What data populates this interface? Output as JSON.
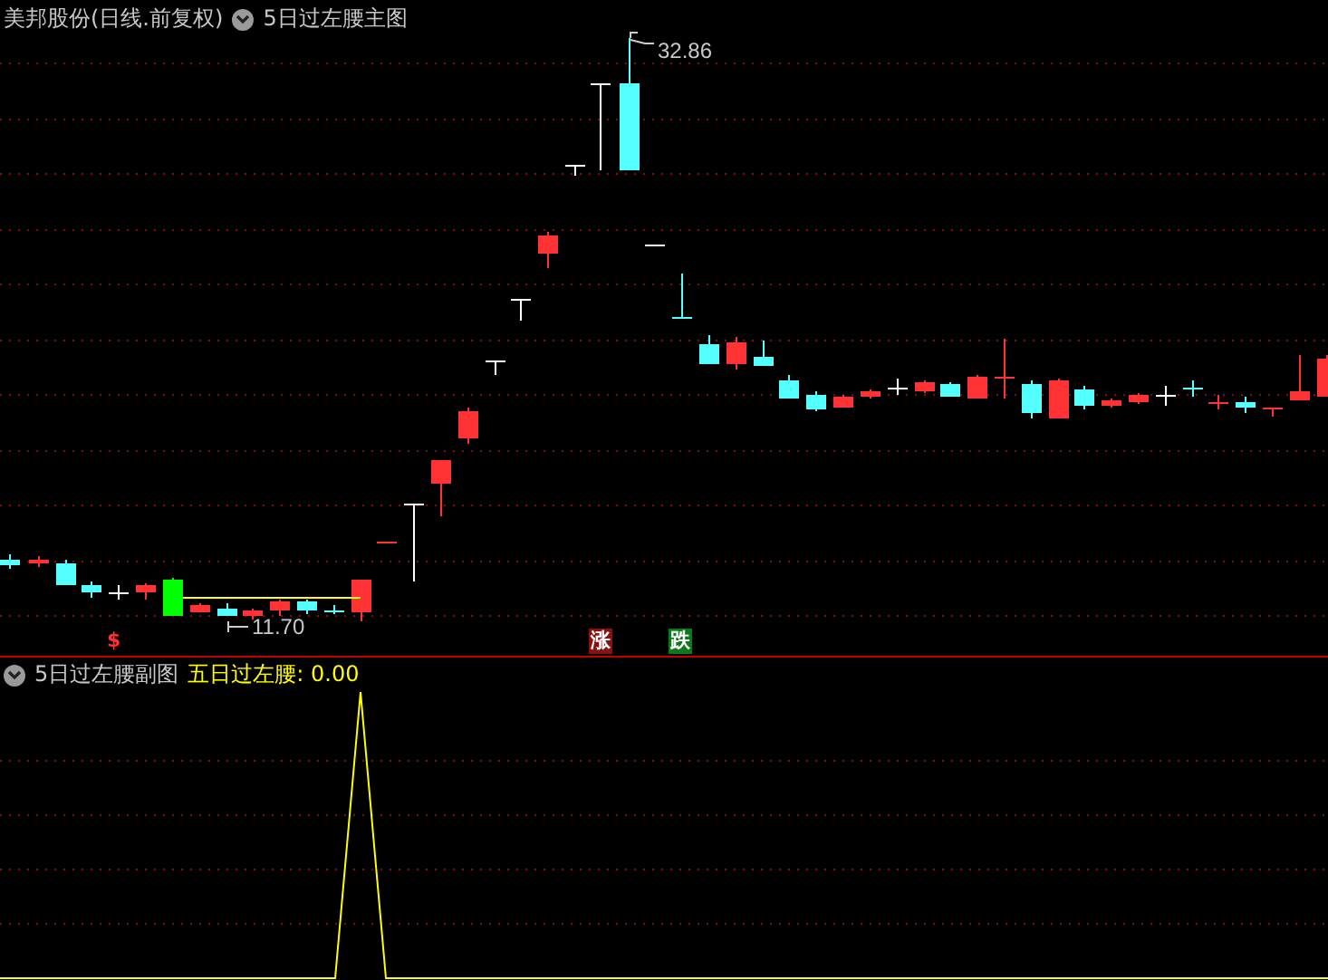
{
  "main_panel": {
    "header": {
      "stock": "美邦股份(日线.前复权)",
      "indicator": "5日过左腰主图"
    },
    "price_labels": [
      {
        "kind": "high",
        "text": "32.86"
      },
      {
        "kind": "low",
        "text": "11.70"
      }
    ],
    "signals": [
      {
        "kind": "dollar",
        "text": "$"
      },
      {
        "kind": "rise",
        "text": "涨"
      },
      {
        "kind": "fall",
        "text": "跌"
      }
    ]
  },
  "sub_panel": {
    "header": {
      "indicator": "5日过左腰副图",
      "reading": "五日过左腰: 0.00"
    }
  }
}
